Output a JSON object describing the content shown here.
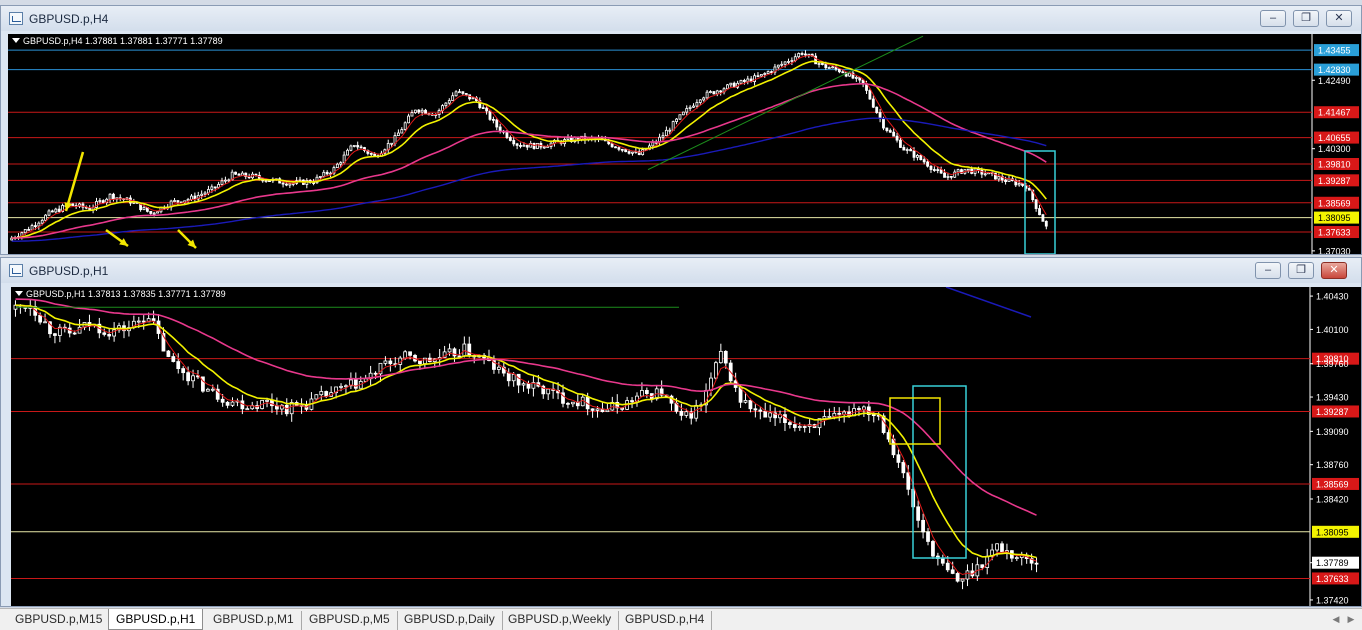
{
  "windows": [
    {
      "title": "GBPUSD.p,H4",
      "info_line": "GBPUSD.p,H4  1.37881 1.37881 1.37771 1.37789",
      "price_min": 1.3693,
      "price_max": 1.4397,
      "price_axis": [
        "1.43455",
        "1.42830",
        "1.42490",
        "1.41467",
        "1.40655",
        "1.40300",
        "1.39810",
        "1.39287",
        "1.38569",
        "1.38095",
        "1.37633",
        "1.37030"
      ],
      "hlines": [
        {
          "price": 1.43455,
          "label": "1.43455",
          "color": "#2a8fd4",
          "tag": "#2a9fd8"
        },
        {
          "price": 1.4283,
          "label": "1.42830",
          "color": "#2a8fd4",
          "tag": "#2a9fd8"
        },
        {
          "price": 1.41467,
          "label": "1.41467",
          "color": "#c81818",
          "tag": "#d81818"
        },
        {
          "price": 1.40655,
          "label": "1.40655",
          "color": "#c81818",
          "tag": "#d81818"
        },
        {
          "price": 1.3981,
          "label": "1.39810",
          "color": "#c81818",
          "tag": "#d81818"
        },
        {
          "price": 1.39287,
          "label": "1.39287",
          "color": "#c81818",
          "tag": "#d81818"
        },
        {
          "price": 1.38569,
          "label": "1.38569",
          "color": "#c81818",
          "tag": "#d81818"
        },
        {
          "price": 1.38095,
          "label": "1.38095",
          "color": "#e8e8a8",
          "tag": "#f4f400"
        },
        {
          "price": 1.37633,
          "label": "1.37633",
          "color": "#c81818",
          "tag": "#d81818"
        }
      ]
    },
    {
      "title": "GBPUSD.p,H1",
      "info_line": "GBPUSD.p,H1  1.37813 1.37835 1.37771 1.37789",
      "price_min": 1.3736,
      "price_max": 1.4052,
      "price_axis": [
        "1.40430",
        "1.40100",
        "1.39760",
        "1.39430",
        "1.39090",
        "1.38760",
        "1.38420",
        "1.38095",
        "1.37789",
        "1.37420"
      ],
      "hlines": [
        {
          "price": 1.3981,
          "label": "1.39810",
          "color": "#c81818",
          "tag": "#d81818"
        },
        {
          "price": 1.39287,
          "label": "1.39287",
          "color": "#c81818",
          "tag": "#d81818"
        },
        {
          "price": 1.38569,
          "label": "1.38569",
          "color": "#c81818",
          "tag": "#d81818"
        },
        {
          "price": 1.38095,
          "label": "1.38095",
          "color": "#e8e8a8",
          "tag": "#f4f400"
        },
        {
          "price": 1.37633,
          "label": "1.37633",
          "color": "#c81818",
          "tag": "#d81818"
        }
      ],
      "current_price": {
        "price": 1.37789,
        "label": "1.37789"
      }
    }
  ],
  "window_buttons": {
    "minimize": "–",
    "restore": "❐",
    "close": "✕"
  },
  "tabs": [
    {
      "label": "GBPUSD.p,M15",
      "active": false
    },
    {
      "label": "GBPUSD.p,H1",
      "active": true
    },
    {
      "label": "GBPUSD.p,M1",
      "active": false
    },
    {
      "label": "GBPUSD.p,M5",
      "active": false
    },
    {
      "label": "GBPUSD.p,Daily",
      "active": false
    },
    {
      "label": "GBPUSD.p,Weekly",
      "active": false
    },
    {
      "label": "GBPUSD.p,H4",
      "active": false
    }
  ],
  "colors": {
    "bg": "#000000",
    "bull": "#ffffff",
    "bear": "#ffffff",
    "ma_fast": "#e01818",
    "ma_mid": "#f2f200",
    "ma_slow": "#e8388c",
    "ma_long": "#1a1ab8",
    "trend": "#1c8c1c",
    "box": "#38d0d8",
    "arrow": "#f2e600"
  },
  "chart_data": [
    {
      "type": "candlestick",
      "symbol": "GBPUSD.p",
      "timeframe": "H4",
      "ohlc_last": {
        "open": 1.37881,
        "high": 1.37881,
        "low": 1.37771,
        "close": 1.37789
      },
      "closes_sampled": [
        1.3738,
        1.3775,
        1.3822,
        1.3851,
        1.3839,
        1.388,
        1.3862,
        1.3823,
        1.3858,
        1.3871,
        1.3899,
        1.3946,
        1.3941,
        1.3928,
        1.3919,
        1.3927,
        1.3965,
        1.4045,
        1.4005,
        1.4063,
        1.4158,
        1.4141,
        1.4212,
        1.4184,
        1.4101,
        1.4045,
        1.4038,
        1.4051,
        1.4062,
        1.4059,
        1.4034,
        1.4011,
        1.4062,
        1.4131,
        1.4195,
        1.4221,
        1.4241,
        1.4263,
        1.43,
        1.4339,
        1.4296,
        1.4278,
        1.4235,
        1.4105,
        1.403,
        1.3989,
        1.3938,
        1.3963,
        1.3951,
        1.3929,
        1.3912,
        1.3779
      ]
    },
    {
      "type": "candlestick",
      "symbol": "GBPUSD.p",
      "timeframe": "H1",
      "ohlc_last": {
        "open": 1.37813,
        "high": 1.37835,
        "low": 1.37771,
        "close": 1.37789
      },
      "closes_sampled": [
        1.403,
        1.4035,
        1.401,
        1.4005,
        1.4015,
        1.4008,
        1.4012,
        1.4025,
        1.398,
        1.3965,
        1.395,
        1.394,
        1.3935,
        1.3938,
        1.3932,
        1.3936,
        1.3945,
        1.3952,
        1.396,
        1.3975,
        1.3982,
        1.3978,
        1.3983,
        1.399,
        1.398,
        1.3965,
        1.3955,
        1.395,
        1.3942,
        1.3938,
        1.393,
        1.3935,
        1.3945,
        1.3948,
        1.392,
        1.3935,
        1.3985,
        1.394,
        1.3925,
        1.392,
        1.3915,
        1.3918,
        1.3922,
        1.3935,
        1.3925,
        1.388,
        1.382,
        1.378,
        1.376,
        1.3775,
        1.3795,
        1.3785,
        1.3779
      ]
    }
  ]
}
